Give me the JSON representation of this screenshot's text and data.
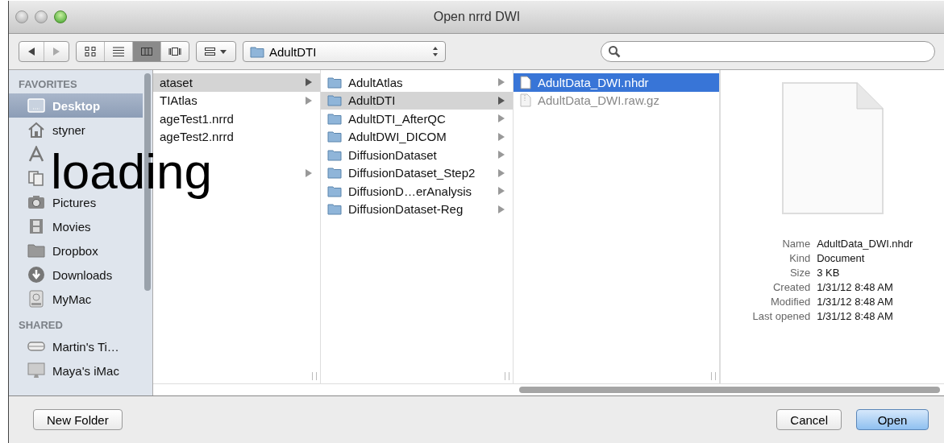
{
  "window": {
    "title": "Open nrrd DWI"
  },
  "toolbar": {
    "nav": [
      {
        "kind": "back",
        "disabled": false
      },
      {
        "kind": "forward",
        "disabled": true
      }
    ],
    "views": [
      {
        "kind": "icons",
        "selected": false
      },
      {
        "kind": "list",
        "selected": false
      },
      {
        "kind": "columns",
        "selected": true
      },
      {
        "kind": "coverflow",
        "selected": false
      }
    ],
    "path": "AdultDTI"
  },
  "sidebar": {
    "sections": [
      {
        "heading": "FAVORITES",
        "items": [
          {
            "kind": "desktop",
            "label": "Desktop",
            "selected": true
          },
          {
            "kind": "home",
            "label": "styner",
            "selected": false
          },
          {
            "kind": "apps",
            "selected": false
          },
          {
            "kind": "documents",
            "selected": false
          },
          {
            "kind": "pictures",
            "label": "Pictures",
            "selected": false
          },
          {
            "kind": "movies",
            "label": "Movies",
            "selected": false
          },
          {
            "kind": "folder",
            "label": "Dropbox",
            "selected": false
          },
          {
            "kind": "downloads",
            "label": "Downloads",
            "selected": false
          },
          {
            "kind": "disk",
            "label": "MyMac",
            "selected": false
          }
        ]
      },
      {
        "heading": "SHARED",
        "items": [
          {
            "kind": "server",
            "label": "Martin's Ti…",
            "selected": false
          },
          {
            "kind": "imac",
            "label": "Maya's iMac",
            "selected": false
          }
        ]
      }
    ]
  },
  "columns": [
    {
      "focused": false,
      "items": [
        {
          "label": "ataset",
          "selected": true,
          "arrow": true
        },
        {
          "label": "TIAtlas",
          "selected": false,
          "arrow": true
        },
        {
          "label": "ageTest1.nrrd",
          "selected": false,
          "arrow": false
        },
        {
          "label": "ageTest2.nrrd",
          "selected": false,
          "arrow": false
        },
        {
          "selected": false,
          "arrow": false
        },
        {
          "selected": false,
          "arrow": true
        }
      ]
    },
    {
      "focused": false,
      "items": [
        {
          "kind": "folder",
          "label": "AdultAtlas",
          "selected": false,
          "arrow": true
        },
        {
          "kind": "folder",
          "label": "AdultDTI",
          "selected": true,
          "arrow": true
        },
        {
          "kind": "folder",
          "label": "AdultDTI_AfterQC",
          "selected": false,
          "arrow": true
        },
        {
          "kind": "folder",
          "label": "AdultDWI_DICOM",
          "selected": false,
          "arrow": true
        },
        {
          "kind": "folder",
          "label": "DiffusionDataset",
          "selected": false,
          "arrow": true
        },
        {
          "kind": "folder",
          "label": "DiffusionDataset_Step2",
          "selected": false,
          "arrow": true
        },
        {
          "kind": "folder",
          "label": "DiffusionD…erAnalysis",
          "selected": false,
          "arrow": true
        },
        {
          "kind": "folder",
          "label": "DiffusionDataset-Reg",
          "selected": false,
          "arrow": true
        }
      ]
    },
    {
      "focused": true,
      "items": [
        {
          "kind": "document",
          "label": "AdultData_DWI.nhdr",
          "selected": true,
          "disabled": false,
          "arrow": false
        },
        {
          "kind": "archive",
          "label": "AdultData_DWI.raw.gz",
          "selected": false,
          "disabled": true,
          "arrow": false
        }
      ]
    }
  ],
  "preview": {
    "info": [
      {
        "label": "Name",
        "value": "AdultData_DWI.nhdr"
      },
      {
        "label": "Kind",
        "value": "Document"
      },
      {
        "label": "Size",
        "value": "3 KB"
      },
      {
        "label": "Created",
        "value": "1/31/12 8:48 AM"
      },
      {
        "label": "Modified",
        "value": "1/31/12 8:48 AM"
      },
      {
        "label": "Last opened",
        "value": "1/31/12 8:48 AM"
      }
    ]
  },
  "buttons": [
    {
      "kind": "secondary",
      "label": "New Folder"
    },
    {
      "kind": "cancel",
      "label": "Cancel"
    },
    {
      "kind": "default",
      "label": "Open"
    }
  ],
  "overlay_caption": "loading"
}
